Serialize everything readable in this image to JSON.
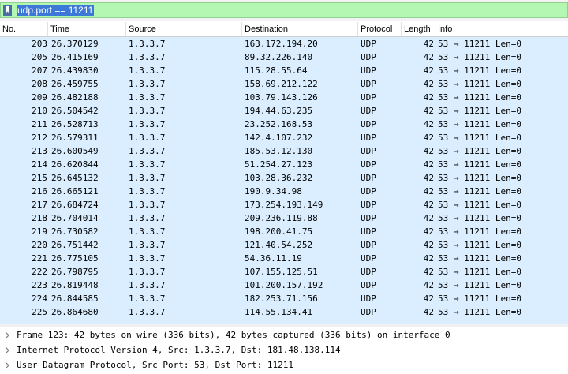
{
  "filter": {
    "value": "udp.port == 11211"
  },
  "columns": [
    "No.",
    "Time",
    "Source",
    "Destination",
    "Protocol",
    "Length",
    "Info"
  ],
  "packets": [
    {
      "no": "203",
      "time": "26.370129",
      "src": "1.3.3.7",
      "dst": "163.172.194.20",
      "proto": "UDP",
      "len": "42",
      "info": "53 → 11211 Len=0"
    },
    {
      "no": "205",
      "time": "26.415169",
      "src": "1.3.3.7",
      "dst": "89.32.226.140",
      "proto": "UDP",
      "len": "42",
      "info": "53 → 11211 Len=0"
    },
    {
      "no": "207",
      "time": "26.439830",
      "src": "1.3.3.7",
      "dst": "115.28.55.64",
      "proto": "UDP",
      "len": "42",
      "info": "53 → 11211 Len=0"
    },
    {
      "no": "208",
      "time": "26.459755",
      "src": "1.3.3.7",
      "dst": "158.69.212.122",
      "proto": "UDP",
      "len": "42",
      "info": "53 → 11211 Len=0"
    },
    {
      "no": "209",
      "time": "26.482188",
      "src": "1.3.3.7",
      "dst": "103.79.143.126",
      "proto": "UDP",
      "len": "42",
      "info": "53 → 11211 Len=0"
    },
    {
      "no": "210",
      "time": "26.504542",
      "src": "1.3.3.7",
      "dst": "194.44.63.235",
      "proto": "UDP",
      "len": "42",
      "info": "53 → 11211 Len=0"
    },
    {
      "no": "211",
      "time": "26.528713",
      "src": "1.3.3.7",
      "dst": "23.252.168.53",
      "proto": "UDP",
      "len": "42",
      "info": "53 → 11211 Len=0"
    },
    {
      "no": "212",
      "time": "26.579311",
      "src": "1.3.3.7",
      "dst": "142.4.107.232",
      "proto": "UDP",
      "len": "42",
      "info": "53 → 11211 Len=0"
    },
    {
      "no": "213",
      "time": "26.600549",
      "src": "1.3.3.7",
      "dst": "185.53.12.130",
      "proto": "UDP",
      "len": "42",
      "info": "53 → 11211 Len=0"
    },
    {
      "no": "214",
      "time": "26.620844",
      "src": "1.3.3.7",
      "dst": "51.254.27.123",
      "proto": "UDP",
      "len": "42",
      "info": "53 → 11211 Len=0"
    },
    {
      "no": "215",
      "time": "26.645132",
      "src": "1.3.3.7",
      "dst": "103.28.36.232",
      "proto": "UDP",
      "len": "42",
      "info": "53 → 11211 Len=0"
    },
    {
      "no": "216",
      "time": "26.665121",
      "src": "1.3.3.7",
      "dst": "190.9.34.98",
      "proto": "UDP",
      "len": "42",
      "info": "53 → 11211 Len=0"
    },
    {
      "no": "217",
      "time": "26.684724",
      "src": "1.3.3.7",
      "dst": "173.254.193.149",
      "proto": "UDP",
      "len": "42",
      "info": "53 → 11211 Len=0"
    },
    {
      "no": "218",
      "time": "26.704014",
      "src": "1.3.3.7",
      "dst": "209.236.119.88",
      "proto": "UDP",
      "len": "42",
      "info": "53 → 11211 Len=0"
    },
    {
      "no": "219",
      "time": "26.730582",
      "src": "1.3.3.7",
      "dst": "198.200.41.75",
      "proto": "UDP",
      "len": "42",
      "info": "53 → 11211 Len=0"
    },
    {
      "no": "220",
      "time": "26.751442",
      "src": "1.3.3.7",
      "dst": "121.40.54.252",
      "proto": "UDP",
      "len": "42",
      "info": "53 → 11211 Len=0"
    },
    {
      "no": "221",
      "time": "26.775105",
      "src": "1.3.3.7",
      "dst": "54.36.11.19",
      "proto": "UDP",
      "len": "42",
      "info": "53 → 11211 Len=0"
    },
    {
      "no": "222",
      "time": "26.798795",
      "src": "1.3.3.7",
      "dst": "107.155.125.51",
      "proto": "UDP",
      "len": "42",
      "info": "53 → 11211 Len=0"
    },
    {
      "no": "223",
      "time": "26.819448",
      "src": "1.3.3.7",
      "dst": "101.200.157.192",
      "proto": "UDP",
      "len": "42",
      "info": "53 → 11211 Len=0"
    },
    {
      "no": "224",
      "time": "26.844585",
      "src": "1.3.3.7",
      "dst": "182.253.71.156",
      "proto": "UDP",
      "len": "42",
      "info": "53 → 11211 Len=0"
    },
    {
      "no": "225",
      "time": "26.864680",
      "src": "1.3.3.7",
      "dst": "114.55.134.41",
      "proto": "UDP",
      "len": "42",
      "info": "53 → 11211 Len=0"
    }
  ],
  "details": [
    "Frame 123: 42 bytes on wire (336 bits), 42 bytes captured (336 bits) on interface 0",
    "Internet Protocol Version 4, Src: 1.3.3.7, Dst: 181.48.138.114",
    "User Datagram Protocol, Src Port: 53, Dst Port: 11211"
  ],
  "icons": {
    "filter_bookmark": "bookmark-icon",
    "expand": "chevron-right-icon"
  },
  "colors": {
    "filter_valid": "#b3f7b3",
    "row_udp": "#daeeff",
    "selection": "#3b78d8"
  }
}
